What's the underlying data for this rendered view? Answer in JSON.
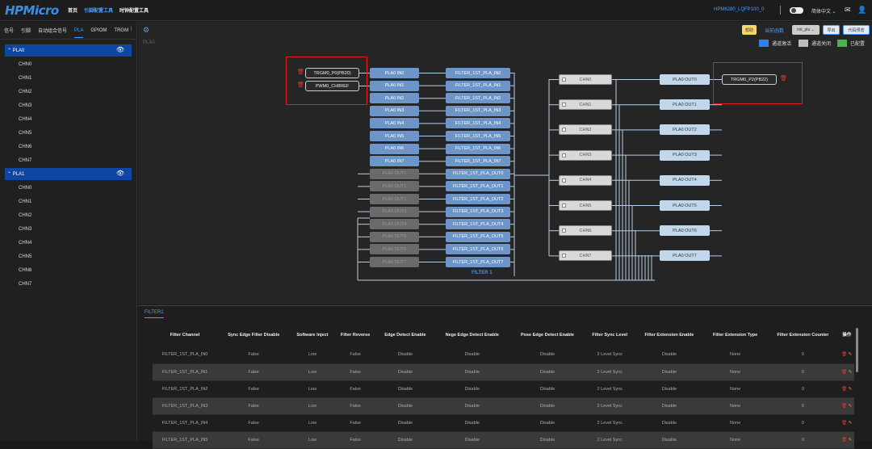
{
  "app": {
    "logo": "HPMicro",
    "nav": [
      "首页",
      "引脚配置工具",
      "时钟配置工具"
    ],
    "chip": "HPM6280_LQFP100_0",
    "lang": "简体中文 ⌄"
  },
  "sidebar": {
    "tabs": [
      "信号",
      "引脚",
      "自动组合信号",
      "PLA",
      "GPIOM",
      "TRGM"
    ],
    "groups": [
      {
        "label": "PLA0",
        "channels": [
          "CHN0",
          "CHN1",
          "CHN2",
          "CHN3",
          "CHN4",
          "CHN5",
          "CHN6",
          "CHN7"
        ]
      },
      {
        "label": "PLA1",
        "channels": [
          "CHN0",
          "CHN1",
          "CHN2",
          "CHN3",
          "CHN4",
          "CHN5",
          "CHN6",
          "CHN7"
        ]
      }
    ]
  },
  "toolbar": {
    "help": "帮助",
    "current_fn_label": "当前函数",
    "fn_select": "init_pla ⌄",
    "export": "导出",
    "code_preview": "代码预览"
  },
  "legend": [
    {
      "label": "通道激活",
      "color": "#2f80ed"
    },
    {
      "label": "通道关闭",
      "color": "#bdbdbd"
    },
    {
      "label": "已配置",
      "color": "#4caf50"
    }
  ],
  "canvas": {
    "title": "PLA0",
    "filter_label": "FILTER 1",
    "input_pins": [
      "TRGM0_P0(PB20)",
      "PWM0_CH8REF"
    ],
    "output_pin": "TRGM0_P2(PB22)",
    "inputs": [
      "PLA0 IN0",
      "PLA0 IN1",
      "PLA0 IN2",
      "PLA0 IN3",
      "PLA0 IN4",
      "PLA0 IN5",
      "PLA0 IN6",
      "PLA0 IN7",
      "PLA0 OUT0",
      "PLA0 OUT1",
      "PLA0 OUT2",
      "PLA0 OUT3",
      "PLA0 OUT4",
      "PLA0 OUT5",
      "PLA0 OUT6",
      "PLA0 OUT7"
    ],
    "filters": [
      "FILTER_1ST_PLA_IN0",
      "FILTER_1ST_PLA_IN1",
      "FILTER_1ST_PLA_IN2",
      "FILTER_1ST_PLA_IN3",
      "FILTER_1ST_PLA_IN4",
      "FILTER_1ST_PLA_IN5",
      "FILTER_1ST_PLA_IN6",
      "FILTER_1ST_PLA_IN7",
      "FILTER_1ST_PLA_OUT0",
      "FILTER_1ST_PLA_OUT1",
      "FILTER_1ST_PLA_OUT2",
      "FILTER_1ST_PLA_OUT3",
      "FILTER_1ST_PLA_OUT4",
      "FILTER_1ST_PLA_OUT5",
      "FILTER_1ST_PLA_OUT6",
      "FILTER_1ST_PLA_OUT7"
    ],
    "channels": [
      "CHN0",
      "CHN1",
      "CHN2",
      "CHN3",
      "CHN4",
      "CHN5",
      "CHN6",
      "CHN7"
    ],
    "outputs": [
      "PLA0 OUT0",
      "PLA0 OUT1",
      "PLA0 OUT2",
      "PLA0 OUT3",
      "PLA0 OUT4",
      "PLA0 OUT5",
      "PLA0 OUT6",
      "PLA0 OUT7"
    ]
  },
  "filter_panel": {
    "tab": "FILTER1",
    "headers": [
      "Filter Channel",
      "Sync Edge Filter Disable",
      "Software Inject",
      "Filter Reverse",
      "Edge Detect Enable",
      "Nege Edge Detect Enable",
      "Pose Edge Detect Enable",
      "Filter Sync Level",
      "Filter Extension Enable",
      "Filter Extension Type",
      "Filter Extension Counter",
      "操作"
    ],
    "rows": [
      [
        "FILTER_1ST_PLA_IN0",
        "False",
        "Low",
        "False",
        "Disable",
        "Disable",
        "Disable",
        "2 Level Sync",
        "Disable",
        "None",
        "0"
      ],
      [
        "FILTER_1ST_PLA_IN1",
        "False",
        "Low",
        "False",
        "Disable",
        "Disable",
        "Disable",
        "2 Level Sync",
        "Disable",
        "None",
        "0"
      ],
      [
        "FILTER_1ST_PLA_IN2",
        "False",
        "Low",
        "False",
        "Disable",
        "Disable",
        "Disable",
        "2 Level Sync",
        "Disable",
        "None",
        "0"
      ],
      [
        "FILTER_1ST_PLA_IN3",
        "False",
        "Low",
        "False",
        "Disable",
        "Disable",
        "Disable",
        "2 Level Sync",
        "Disable",
        "None",
        "0"
      ],
      [
        "FILTER_1ST_PLA_IN4",
        "False",
        "Low",
        "False",
        "Disable",
        "Disable",
        "Disable",
        "2 Level Sync",
        "Disable",
        "None",
        "0"
      ],
      [
        "FILTER_1ST_PLA_IN5",
        "False",
        "Low",
        "False",
        "Disable",
        "Disable",
        "Disable",
        "2 Level Sync",
        "Disable",
        "None",
        "0"
      ]
    ]
  }
}
